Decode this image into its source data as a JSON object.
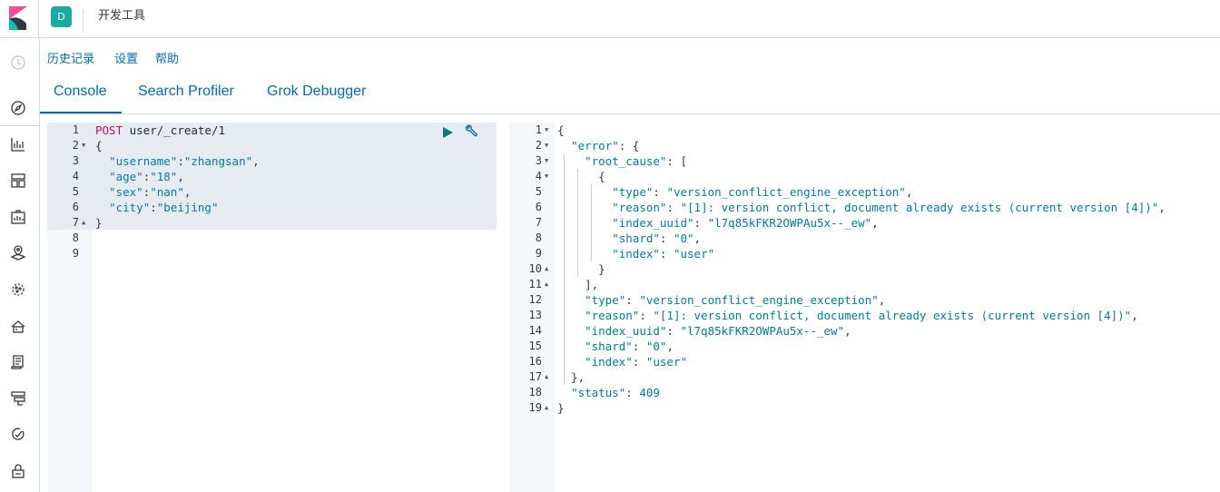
{
  "header": {
    "space_initial": "D",
    "app_title": "开发工具"
  },
  "sidebar": {
    "items": [
      {
        "icon": "clock-icon"
      },
      {
        "icon": "discover-icon"
      },
      {
        "icon": "visualize-icon"
      },
      {
        "icon": "dashboard-icon"
      },
      {
        "icon": "canvas-icon"
      },
      {
        "icon": "maps-icon"
      },
      {
        "icon": "ml-icon"
      },
      {
        "icon": "infrastructure-icon"
      },
      {
        "icon": "logs-icon"
      },
      {
        "icon": "apm-icon"
      },
      {
        "icon": "uptime-icon"
      },
      {
        "icon": "siem-icon"
      }
    ]
  },
  "top_links": {
    "history": "历史记录",
    "settings": "设置",
    "help": "帮助"
  },
  "tabs": [
    "Console",
    "Search Profiler",
    "Grok Debugger"
  ],
  "request": {
    "lines": [
      {
        "n": "1",
        "t": [
          [
            "kw-method",
            "POST"
          ],
          [
            "kw-url",
            " user/_create/1"
          ]
        ]
      },
      {
        "n": "2",
        "f": "▼",
        "t": [
          [
            "j-punc",
            "{"
          ]
        ]
      },
      {
        "n": "3",
        "t": [
          [
            "j-punc",
            "  "
          ],
          [
            "j-key",
            "\"username\""
          ],
          [
            "j-punc",
            ":"
          ],
          [
            "j-str",
            "\"zhangsan\""
          ],
          [
            "j-punc",
            ","
          ]
        ]
      },
      {
        "n": "4",
        "t": [
          [
            "j-punc",
            "  "
          ],
          [
            "j-key",
            "\"age\""
          ],
          [
            "j-punc",
            ":"
          ],
          [
            "j-str",
            "\"18\""
          ],
          [
            "j-punc",
            ","
          ]
        ]
      },
      {
        "n": "5",
        "t": [
          [
            "j-punc",
            "  "
          ],
          [
            "j-key",
            "\"sex\""
          ],
          [
            "j-punc",
            ":"
          ],
          [
            "j-str",
            "\"nan\""
          ],
          [
            "j-punc",
            ","
          ]
        ]
      },
      {
        "n": "6",
        "t": [
          [
            "j-punc",
            "  "
          ],
          [
            "j-key",
            "\"city\""
          ],
          [
            "j-punc",
            ":"
          ],
          [
            "j-str",
            "\"beijing\""
          ]
        ]
      },
      {
        "n": "7",
        "f": "▲",
        "t": [
          [
            "j-punc",
            "}"
          ]
        ]
      },
      {
        "n": "8",
        "t": []
      },
      {
        "n": "9",
        "t": []
      }
    ]
  },
  "response": {
    "lines": [
      {
        "n": "1",
        "f": "▼",
        "t": [
          [
            "j-punc",
            "{"
          ]
        ]
      },
      {
        "n": "2",
        "f": "▼",
        "t": [
          [
            "j-punc",
            "  "
          ],
          [
            "j-key",
            "\"error\""
          ],
          [
            "j-punc",
            ": {"
          ]
        ]
      },
      {
        "n": "3",
        "f": "▼",
        "t": [
          [
            "j-punc",
            "    "
          ],
          [
            "j-key",
            "\"root_cause\""
          ],
          [
            "j-punc",
            ": ["
          ]
        ]
      },
      {
        "n": "4",
        "f": "▼",
        "t": [
          [
            "j-punc",
            "      {"
          ]
        ]
      },
      {
        "n": "5",
        "t": [
          [
            "j-punc",
            "        "
          ],
          [
            "j-key",
            "\"type\""
          ],
          [
            "j-punc",
            ": "
          ],
          [
            "j-str",
            "\"version_conflict_engine_exception\""
          ],
          [
            "j-punc",
            ","
          ]
        ]
      },
      {
        "n": "6",
        "t": [
          [
            "j-punc",
            "        "
          ],
          [
            "j-key",
            "\"reason\""
          ],
          [
            "j-punc",
            ": "
          ],
          [
            "j-str",
            "\"[1]: version conflict, document already exists (current version [4])\""
          ],
          [
            "j-punc",
            ","
          ]
        ]
      },
      {
        "n": "7",
        "t": [
          [
            "j-punc",
            "        "
          ],
          [
            "j-key",
            "\"index_uuid\""
          ],
          [
            "j-punc",
            ": "
          ],
          [
            "j-str",
            "\"l7q85kFKR2OWPAu5x--_ew\""
          ],
          [
            "j-punc",
            ","
          ]
        ]
      },
      {
        "n": "8",
        "t": [
          [
            "j-punc",
            "        "
          ],
          [
            "j-key",
            "\"shard\""
          ],
          [
            "j-punc",
            ": "
          ],
          [
            "j-str",
            "\"0\""
          ],
          [
            "j-punc",
            ","
          ]
        ]
      },
      {
        "n": "9",
        "t": [
          [
            "j-punc",
            "        "
          ],
          [
            "j-key",
            "\"index\""
          ],
          [
            "j-punc",
            ": "
          ],
          [
            "j-str",
            "\"user\""
          ]
        ]
      },
      {
        "n": "10",
        "f": "▲",
        "t": [
          [
            "j-punc",
            "      }"
          ]
        ]
      },
      {
        "n": "11",
        "f": "▲",
        "t": [
          [
            "j-punc",
            "    ],"
          ]
        ]
      },
      {
        "n": "12",
        "t": [
          [
            "j-punc",
            "    "
          ],
          [
            "j-key",
            "\"type\""
          ],
          [
            "j-punc",
            ": "
          ],
          [
            "j-str",
            "\"version_conflict_engine_exception\""
          ],
          [
            "j-punc",
            ","
          ]
        ]
      },
      {
        "n": "13",
        "t": [
          [
            "j-punc",
            "    "
          ],
          [
            "j-key",
            "\"reason\""
          ],
          [
            "j-punc",
            ": "
          ],
          [
            "j-str",
            "\"[1]: version conflict, document already exists (current version [4])\""
          ],
          [
            "j-punc",
            ","
          ]
        ]
      },
      {
        "n": "14",
        "t": [
          [
            "j-punc",
            "    "
          ],
          [
            "j-key",
            "\"index_uuid\""
          ],
          [
            "j-punc",
            ": "
          ],
          [
            "j-str",
            "\"l7q85kFKR2OWPAu5x--_ew\""
          ],
          [
            "j-punc",
            ","
          ]
        ]
      },
      {
        "n": "15",
        "t": [
          [
            "j-punc",
            "    "
          ],
          [
            "j-key",
            "\"shard\""
          ],
          [
            "j-punc",
            ": "
          ],
          [
            "j-str",
            "\"0\""
          ],
          [
            "j-punc",
            ","
          ]
        ]
      },
      {
        "n": "16",
        "t": [
          [
            "j-punc",
            "    "
          ],
          [
            "j-key",
            "\"index\""
          ],
          [
            "j-punc",
            ": "
          ],
          [
            "j-str",
            "\"user\""
          ]
        ]
      },
      {
        "n": "17",
        "f": "▲",
        "t": [
          [
            "j-punc",
            "  },"
          ]
        ]
      },
      {
        "n": "18",
        "t": [
          [
            "j-punc",
            "  "
          ],
          [
            "j-key",
            "\"status\""
          ],
          [
            "j-punc",
            ": "
          ],
          [
            "j-num",
            "409"
          ]
        ]
      },
      {
        "n": "19",
        "f": "▲",
        "t": [
          [
            "j-punc",
            "}"
          ]
        ]
      }
    ]
  },
  "colors": {
    "accent": "#006bb4",
    "avatar": "#1ba9a0",
    "method": "#c80a68",
    "run": "#017d73"
  }
}
